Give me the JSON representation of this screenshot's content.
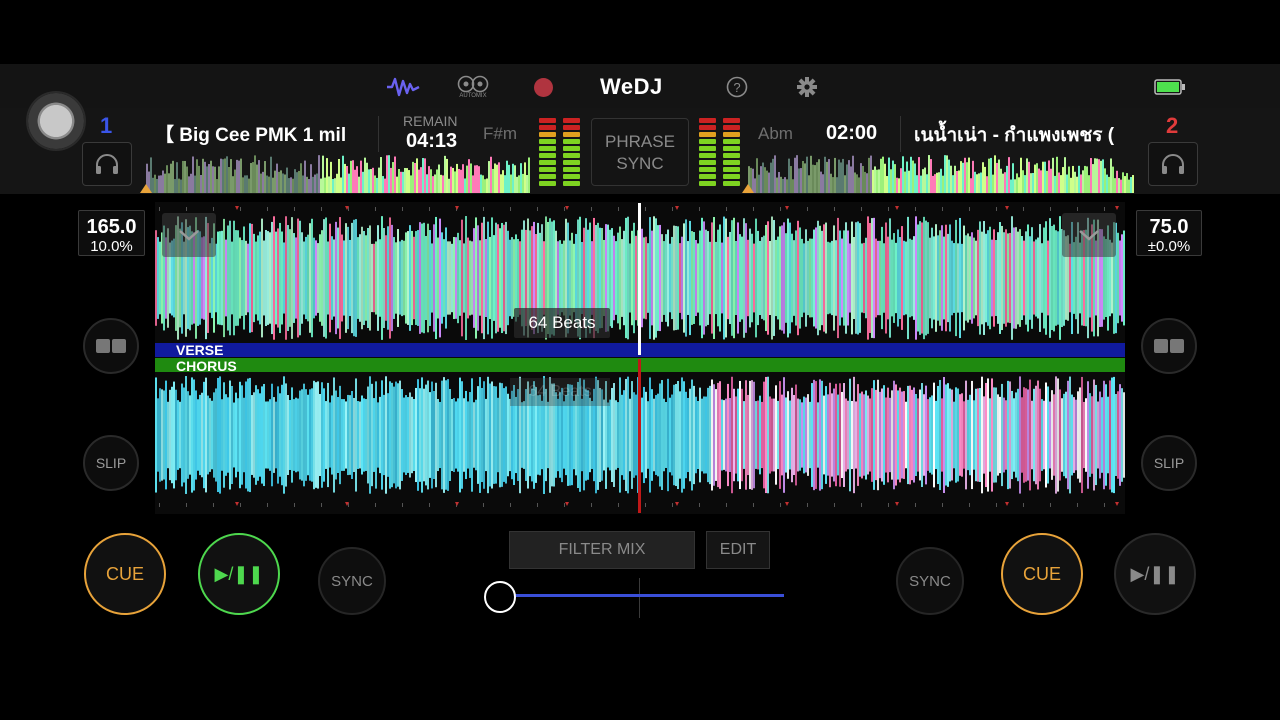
{
  "app": {
    "logo": "WeDJ",
    "automix_label": "AUTOMIX"
  },
  "colors": {
    "accent_blue": "#3a4fd8",
    "cue_orange": "#e8a33a",
    "play_green": "#4ed84e",
    "deck1_blue": "#3a55e8",
    "deck2_red": "#e03b3b",
    "verse_blue": "#101a9e",
    "chorus_green": "#1f8a10"
  },
  "toolbar": {
    "icons": [
      "waveform-icon",
      "automix-icon",
      "record-icon",
      "help-icon",
      "gear-icon",
      "battery-icon"
    ]
  },
  "deck1": {
    "number": "1",
    "title": "【 Big Cee PMK 1 mil",
    "remain_label": "REMAIN",
    "remain_time": "04:13",
    "key": "F#m",
    "bpm": "165.0",
    "pitch": "10.0%"
  },
  "deck2": {
    "number": "2",
    "title": "เนน้ำเน่า - กำแพงเพชร (",
    "time": "02:00",
    "key": "Abm",
    "bpm": "75.0",
    "pitch": "±0.0%"
  },
  "center": {
    "phrase_sync_line1": "PHRASE",
    "phrase_sync_line2": "SYNC"
  },
  "waveform": {
    "beats_label": "64 Beats",
    "beats_label_faded": "64 Beats",
    "segment_verse": "VERSE",
    "segment_chorus": "CHORUS"
  },
  "side_buttons": {
    "slip": "SLIP"
  },
  "controls": {
    "cue": "CUE",
    "play_pause": "▶/❚❚",
    "sync": "SYNC",
    "filter_mix": "FILTER MIX",
    "edit": "EDIT",
    "crossfader_position": 0
  }
}
